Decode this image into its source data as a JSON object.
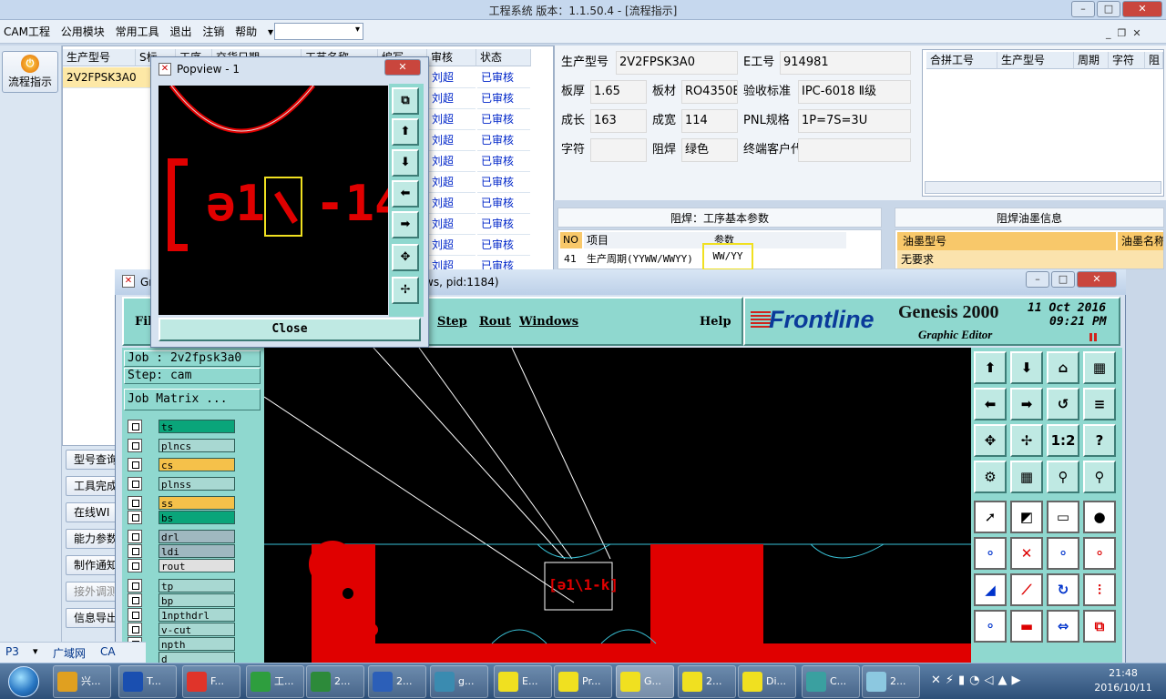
{
  "app": {
    "title": "工程系统   版本：1.1.50.4 - [流程指示]"
  },
  "menu": [
    "CAM工程",
    "公用模块",
    "常用工具",
    "退出",
    "注销",
    "帮助"
  ],
  "sidebar": {
    "flow_label": "流程指示"
  },
  "list": {
    "headers": [
      "生产型号",
      "S标",
      "工序",
      "交货日期",
      "工艺名称",
      "编写",
      "审核",
      "状态"
    ],
    "selected_model": "2V2FPSK3A0",
    "rows": [
      {
        "review": "刘超",
        "status": "已审核"
      },
      {
        "review": "刘超",
        "status": "已审核"
      },
      {
        "review": "刘超",
        "status": "已审核"
      },
      {
        "review": "刘超",
        "status": "已审核"
      },
      {
        "review": "刘超",
        "status": "已审核"
      },
      {
        "review": "刘超",
        "status": "已审核"
      },
      {
        "review": "刘超",
        "status": "已审核"
      },
      {
        "review": "刘超",
        "status": "已审核"
      },
      {
        "review": "刘超",
        "status": "已审核"
      },
      {
        "review": "刘超",
        "status": "已审核"
      }
    ],
    "buttons": [
      "型号查询",
      "工具完成",
      "在线WI",
      "能力参数",
      "制作通知",
      "接外调测",
      "信息导出"
    ]
  },
  "info": {
    "model_label": "生产型号",
    "model": "2V2FPSK3A0",
    "eno_label": "E工号",
    "eno": "914981",
    "thick_label": "板厚",
    "thick": "1.65",
    "mat_label": "板材",
    "mat": "RO4350B",
    "std_label": "验收标准",
    "std": "IPC-6018 Ⅱ级",
    "len_label": "成长",
    "len": "163",
    "wid_label": "成宽",
    "wid": "114",
    "pnl_label": "PNL规格",
    "pnl": "1P=7S=3U",
    "char_label": "字符",
    "char": "",
    "mask_label": "阻焊",
    "mask": "绿色",
    "cust_label": "终端客户代码",
    "cust": "",
    "merge_headers": [
      "合拼工号",
      "生产型号",
      "周期",
      "字符",
      "阻焊"
    ]
  },
  "params": {
    "title": "阻焊：工序基本参数",
    "headers": [
      "NO",
      "项目",
      "参数"
    ],
    "row": {
      "no": "41",
      "item": "生产周期(YYWW/WWYY)",
      "value": "WW/YY"
    },
    "ink_title": "阻焊油墨信息",
    "ink_headers": [
      "油墨型号",
      "油墨名称"
    ],
    "ink_row": "无要求"
  },
  "status": {
    "p3": "P3",
    "net": "广域网",
    "ca": "CA"
  },
  "genesis": {
    "title_fragment": "ws, pid:1184)",
    "menu": [
      "Fil",
      "Step",
      "Rout",
      "Windows",
      "Help"
    ],
    "brand": "Frontline",
    "product": "Genesis 2000",
    "subtitle": "Graphic Editor",
    "date": "11 Oct 2016",
    "time": "09:21 PM",
    "job": "Job : 2v2fpsk3a0",
    "step": "Step: cam",
    "job_matrix": "Job Matrix ...",
    "layers": [
      {
        "name": "ts",
        "color": "#0aa57a"
      },
      {
        "name": "plncs",
        "color": "#a8d8d2"
      },
      {
        "name": "cs",
        "color": "#f5c14a"
      },
      {
        "name": "plnss",
        "color": "#a8d8d2"
      },
      {
        "name": "ss",
        "color": "#f5c14a"
      },
      {
        "name": "bs",
        "color": "#0aa57a"
      },
      {
        "name": "drl",
        "color": "#9fb8c0"
      },
      {
        "name": "ldi",
        "color": "#9fb8c0"
      },
      {
        "name": "rout",
        "color": "#e0e0e0"
      },
      {
        "name": "tp",
        "color": "#a8d8d2"
      },
      {
        "name": "bp",
        "color": "#a8d8d2"
      },
      {
        "name": "1npthdrl",
        "color": "#a8d8d2"
      },
      {
        "name": "v-cut",
        "color": "#a8d8d2"
      },
      {
        "name": "npth",
        "color": "#a8d8d2"
      },
      {
        "name": "d",
        "color": "#a8d8d2"
      }
    ],
    "tools": [
      "1:2",
      "?"
    ]
  },
  "popview": {
    "title": "Popview - 1",
    "close": "Close"
  },
  "taskbar": {
    "items": [
      "兴...",
      "T...",
      "F...",
      "工...",
      "2...",
      "2...",
      "g...",
      "E...",
      "Pr...",
      "G...",
      "2...",
      "Di...",
      "C...",
      "2..."
    ],
    "time": "21:48",
    "date": "2016/10/11"
  }
}
